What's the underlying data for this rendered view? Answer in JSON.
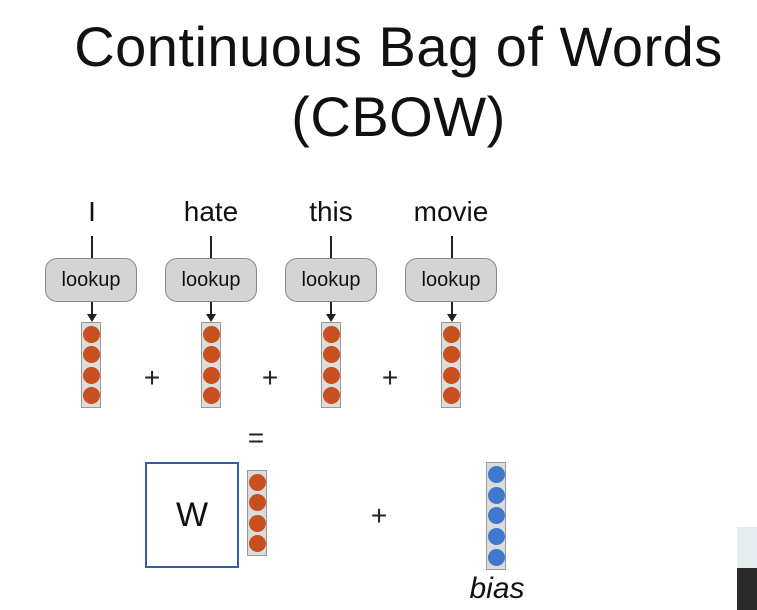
{
  "title": {
    "line1": "Continuous Bag of Words",
    "line2": "(CBOW)"
  },
  "words": [
    "I",
    "hate",
    "this",
    "movie"
  ],
  "lookup_label": "lookup",
  "operators": {
    "plus": "+",
    "equals": "="
  },
  "matrix_label": "W",
  "bias_label": "bias",
  "colors": {
    "embedding": "#c8501e",
    "bias": "#3f78cc",
    "matrix_border": "#2f5da8",
    "lookup_fill": "#d4d4d4"
  }
}
